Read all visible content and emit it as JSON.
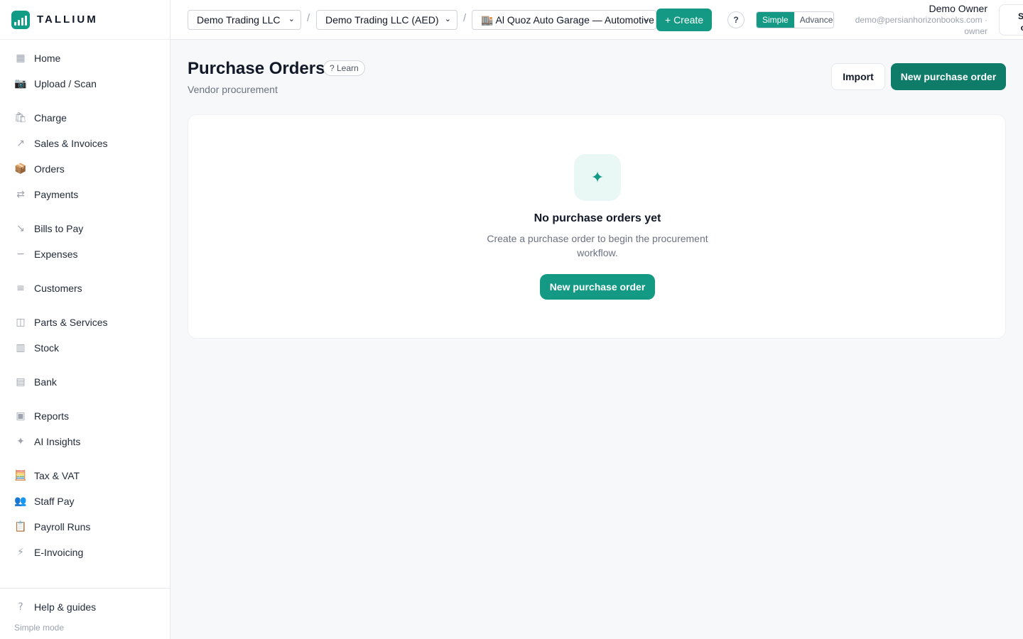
{
  "app": {
    "name": "TALLIUM"
  },
  "sidebar": {
    "items": [
      {
        "label": "Home",
        "icon": "grid-icon",
        "glyph": "▦"
      },
      {
        "label": "Upload / Scan",
        "icon": "camera-icon",
        "glyph": "📷"
      },
      {
        "label": "Charge",
        "icon": "shopping-bag-icon",
        "glyph": "🛍"
      },
      {
        "label": "Sales & Invoices",
        "icon": "arrow-up-right-icon",
        "glyph": "↗"
      },
      {
        "label": "Orders",
        "icon": "package-icon",
        "glyph": "📦"
      },
      {
        "label": "Payments",
        "icon": "arrows-exchange-icon",
        "glyph": "⇄"
      },
      {
        "label": "Bills to Pay",
        "icon": "arrow-down-right-icon",
        "glyph": "↘"
      },
      {
        "label": "Expenses",
        "icon": "minus-icon",
        "glyph": "−"
      },
      {
        "label": "Customers",
        "icon": "list-icon",
        "glyph": "≡"
      },
      {
        "label": "Parts & Services",
        "icon": "box-icon",
        "glyph": "◫"
      },
      {
        "label": "Stock",
        "icon": "shelves-icon",
        "glyph": "▥"
      },
      {
        "label": "Bank",
        "icon": "bank-icon",
        "glyph": "▤"
      },
      {
        "label": "Reports",
        "icon": "report-icon",
        "glyph": "▣"
      },
      {
        "label": "AI Insights",
        "icon": "sparkle-icon",
        "glyph": "✦"
      },
      {
        "label": "Tax & VAT",
        "icon": "abacus-icon",
        "glyph": "🧮"
      },
      {
        "label": "Staff Pay",
        "icon": "people-icon",
        "glyph": "👥"
      },
      {
        "label": "Payroll Runs",
        "icon": "clipboard-icon",
        "glyph": "📋"
      },
      {
        "label": "E-Invoicing",
        "icon": "lightning-icon",
        "glyph": "⚡"
      }
    ],
    "help_label": "Help & guides",
    "mode_note": "Simple mode"
  },
  "topbar": {
    "company": "Demo Trading LLC",
    "currency_company": "Demo Trading LLC (AED)",
    "branch": "🏬 Al Quoz Auto Garage — Automotive",
    "create_label": "+ Create",
    "help": "?",
    "mode_simple": "Simple",
    "mode_advanced": "Advanced",
    "user_name": "Demo Owner",
    "user_email": "demo@persianhorizonbooks.com · owner",
    "signout_label": "Sign out"
  },
  "page": {
    "title": "Purchase Orders",
    "learn_label": "? Learn",
    "subtitle": "Vendor procurement",
    "import_label": "Import",
    "new_label": "New purchase order"
  },
  "empty_state": {
    "icon": "sparkle-icon",
    "title": "No purchase orders yet",
    "description": "Create a purchase order to begin the procurement workflow.",
    "button_label": "New purchase order"
  },
  "colors": {
    "accent": "#149a84",
    "accent_dark": "#0f7c6a"
  }
}
